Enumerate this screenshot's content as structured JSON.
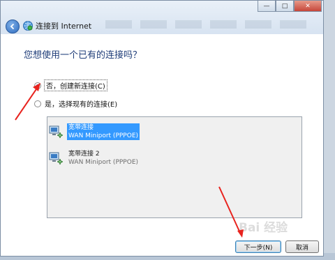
{
  "window": {
    "title": "连接到 Internet",
    "controls": {
      "minimize": "—",
      "maximize": "□",
      "close": "✕"
    }
  },
  "dialog": {
    "heading": "您想使用一个已有的连接吗？",
    "options": [
      {
        "label": "否，创建新连接(C)",
        "checked": true
      },
      {
        "label": "是，选择现有的连接(E)",
        "checked": false
      }
    ],
    "connections": [
      {
        "name": "宽带连接",
        "type": "WAN Miniport (PPPOE)",
        "selected": true
      },
      {
        "name": "宽带连接 2",
        "type": "WAN Miniport (PPPOE)",
        "selected": false
      }
    ],
    "buttons": {
      "next": "下一步(N)",
      "cancel": "取消"
    }
  },
  "watermark": "Bai 经验",
  "colors": {
    "arrow": "#e8231e",
    "selection": "#3399ff",
    "heading": "#1e3c78"
  }
}
